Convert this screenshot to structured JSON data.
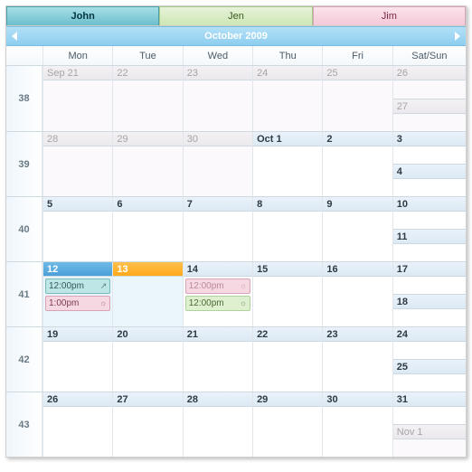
{
  "tabs": [
    {
      "label": "John",
      "class": "john"
    },
    {
      "label": "Jen",
      "class": "jen"
    },
    {
      "label": "Jim",
      "class": "jim"
    }
  ],
  "month_title": "October 2009",
  "dow": [
    "",
    "Mon",
    "Tue",
    "Wed",
    "Thu",
    "Fri",
    "Sat/Sun"
  ],
  "weeks": [
    {
      "num": "38",
      "days": [
        {
          "label": "Sep 21",
          "other": true
        },
        {
          "label": "22",
          "other": true
        },
        {
          "label": "23",
          "other": true
        },
        {
          "label": "24",
          "other": true
        },
        {
          "label": "25",
          "other": true
        }
      ],
      "sat": {
        "label": "26",
        "other": true
      },
      "sun": {
        "label": "27",
        "other": true
      }
    },
    {
      "num": "39",
      "days": [
        {
          "label": "28",
          "other": true
        },
        {
          "label": "29",
          "other": true
        },
        {
          "label": "30",
          "other": true
        },
        {
          "label": "Oct 1",
          "bold": true
        },
        {
          "label": "2",
          "bold": true
        }
      ],
      "sat": {
        "label": "3",
        "bold": true
      },
      "sun": {
        "label": "4",
        "bold": true
      }
    },
    {
      "num": "40",
      "days": [
        {
          "label": "5",
          "bold": true
        },
        {
          "label": "6",
          "bold": true
        },
        {
          "label": "7",
          "bold": true
        },
        {
          "label": "8",
          "bold": true
        },
        {
          "label": "9",
          "bold": true
        }
      ],
      "sat": {
        "label": "10",
        "bold": true
      },
      "sun": {
        "label": "11",
        "bold": true
      }
    },
    {
      "num": "41",
      "days": [
        {
          "label": "12",
          "sel": "blue",
          "events": [
            {
              "time": "12:00pm",
              "class": "ev-teal",
              "glyph": "↗"
            },
            {
              "time": "1:00pm",
              "class": "ev-pink",
              "glyph": "☼"
            }
          ]
        },
        {
          "label": "13",
          "sel": "orange"
        },
        {
          "label": "14",
          "bold": true,
          "events": [
            {
              "time": "12:00pm",
              "class": "ev-pink faded",
              "glyph": "☼"
            },
            {
              "time": "12:00pm",
              "class": "ev-green",
              "glyph": "☼"
            }
          ]
        },
        {
          "label": "15",
          "bold": true
        },
        {
          "label": "16",
          "bold": true
        }
      ],
      "sat": {
        "label": "17",
        "bold": true
      },
      "sun": {
        "label": "18",
        "bold": true
      }
    },
    {
      "num": "42",
      "days": [
        {
          "label": "19",
          "bold": true
        },
        {
          "label": "20",
          "bold": true
        },
        {
          "label": "21",
          "bold": true
        },
        {
          "label": "22",
          "bold": true
        },
        {
          "label": "23",
          "bold": true
        }
      ],
      "sat": {
        "label": "24",
        "bold": true
      },
      "sun": {
        "label": "25",
        "bold": true
      }
    },
    {
      "num": "43",
      "days": [
        {
          "label": "26",
          "bold": true
        },
        {
          "label": "27",
          "bold": true
        },
        {
          "label": "28",
          "bold": true
        },
        {
          "label": "29",
          "bold": true
        },
        {
          "label": "30",
          "bold": true
        }
      ],
      "sat": {
        "label": "31",
        "bold": true
      },
      "sun": {
        "label": "Nov 1",
        "other": true
      }
    }
  ]
}
